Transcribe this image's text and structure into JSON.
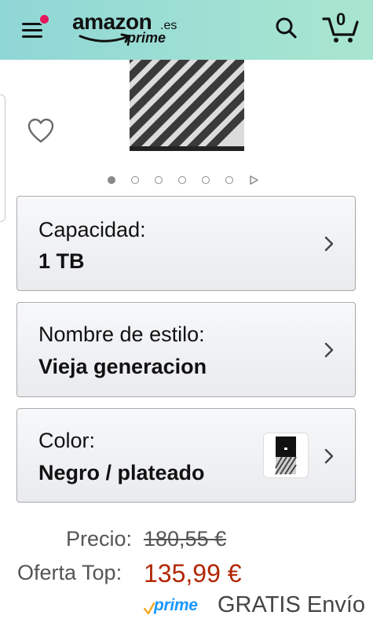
{
  "header": {
    "logo_word": "amazon",
    "logo_tld": ".es",
    "logo_prime": "prime",
    "cart_count": "0",
    "brand_color": "#9fe0d2",
    "notification_color": "#e4185b"
  },
  "gallery": {
    "image_count": 6,
    "active_index": 0
  },
  "variants": [
    {
      "label": "Capacidad:",
      "value": "1 TB"
    },
    {
      "label": "Nombre de estilo:",
      "value": "Vieja generacion"
    },
    {
      "label": "Color:",
      "value": "Negro / plateado"
    }
  ],
  "pricing": {
    "list_label": "Precio:",
    "list_price": "180,55 €",
    "deal_label": "Oferta Top:",
    "deal_price": "135,99 €",
    "deal_color": "#b12704"
  },
  "delivery": {
    "prime_label": "prime",
    "prime_color": "#1a98ff",
    "shipping_text": "GRATIS Envío"
  }
}
